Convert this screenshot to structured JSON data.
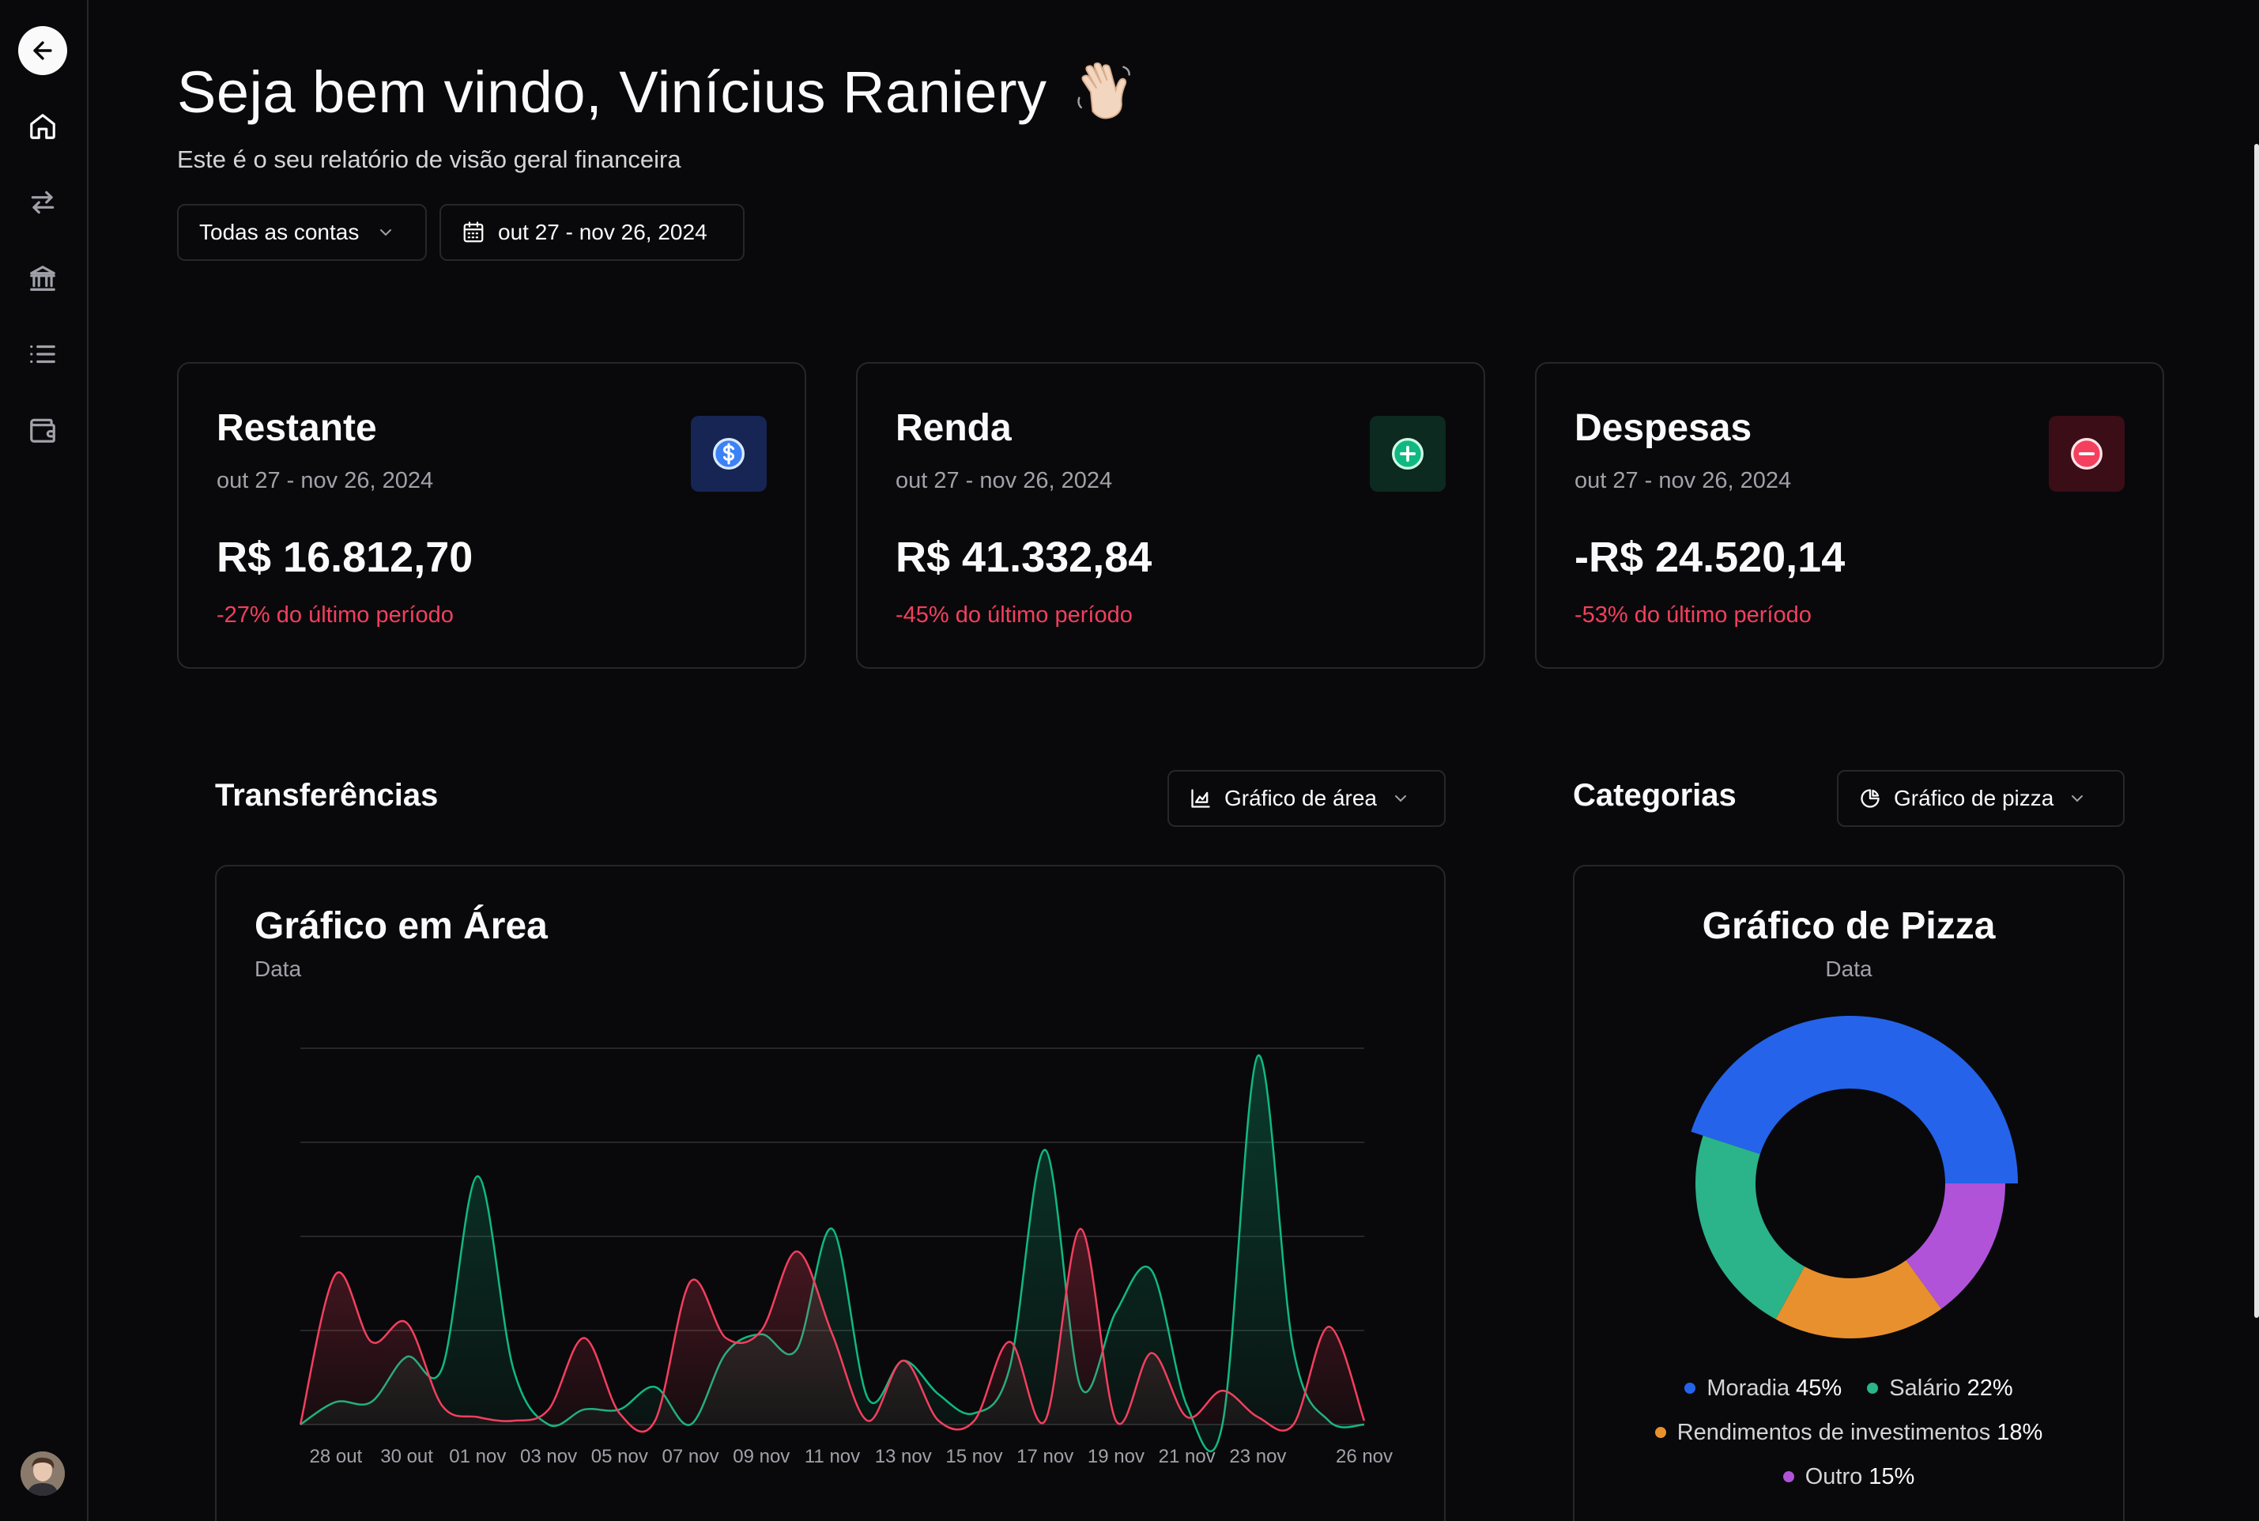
{
  "header": {
    "title": "Seja bem vindo, Vinícius Raniery",
    "subtitle": "Este é o seu relatório de visão geral financeira"
  },
  "filters": {
    "account_label": "Todas as contas",
    "date_range_label": "out 27 - nov 26, 2024"
  },
  "sidebar": {
    "items": [
      "home-icon",
      "transfers-icon",
      "bank-icon",
      "list-icon",
      "wallet-icon"
    ]
  },
  "cards": [
    {
      "title": "Restante",
      "date": "out 27 - nov 26, 2024",
      "value": "R$ 16.812,70",
      "change": "-27% do último período",
      "icon": "dollar-icon",
      "accent": "#3b82f6"
    },
    {
      "title": "Renda",
      "date": "out 27 - nov 26, 2024",
      "value": "R$ 41.332,84",
      "change": "-45% do último período",
      "icon": "plus-icon",
      "accent": "#10b981"
    },
    {
      "title": "Despesas",
      "date": "out 27 - nov 26, 2024",
      "value": "-R$ 24.520,14",
      "change": "-53% do último período",
      "icon": "minus-icon",
      "accent": "#f43f5e"
    }
  ],
  "transfers": {
    "section_title": "Transferências",
    "selector_label": "Gráfico de área",
    "panel_title": "Gráfico em Área",
    "panel_subtitle": "Data"
  },
  "categories": {
    "section_title": "Categorias",
    "selector_label": "Gráfico de pizza",
    "panel_title": "Gráfico de Pizza",
    "panel_subtitle": "Data"
  },
  "chart_data": [
    {
      "type": "area",
      "title": "Gráfico em Área",
      "subtitle": "Data",
      "x_tick_labels": [
        "28 out",
        "30 out",
        "01 nov",
        "03 nov",
        "05 nov",
        "07 nov",
        "09 nov",
        "11 nov",
        "13 nov",
        "15 nov",
        "17 nov",
        "19 nov",
        "21 nov",
        "23 nov",
        "26 nov"
      ],
      "x": [
        "27 out",
        "28 out",
        "29 out",
        "30 out",
        "31 out",
        "01 nov",
        "02 nov",
        "03 nov",
        "04 nov",
        "05 nov",
        "06 nov",
        "07 nov",
        "08 nov",
        "09 nov",
        "10 nov",
        "11 nov",
        "12 nov",
        "13 nov",
        "14 nov",
        "15 nov",
        "16 nov",
        "17 nov",
        "18 nov",
        "19 nov",
        "20 nov",
        "21 nov",
        "22 nov",
        "23 nov",
        "24 nov",
        "25 nov",
        "26 nov"
      ],
      "series": [
        {
          "color": "#10b981",
          "values": [
            0,
            12,
            12,
            36,
            30,
            132,
            30,
            0,
            8,
            8,
            20,
            0,
            38,
            48,
            40,
            104,
            14,
            34,
            16,
            6,
            30,
            146,
            20,
            60,
            82,
            10,
            0,
            196,
            40,
            2,
            0
          ]
        },
        {
          "color": "#f43f5e",
          "values": [
            0,
            80,
            44,
            54,
            10,
            4,
            2,
            8,
            46,
            6,
            2,
            76,
            46,
            50,
            92,
            48,
            2,
            34,
            2,
            2,
            44,
            2,
            104,
            2,
            38,
            4,
            18,
            4,
            0,
            52,
            2
          ]
        }
      ],
      "ylim": [
        0,
        200
      ],
      "grid": true
    },
    {
      "type": "pie",
      "title": "Gráfico de Pizza",
      "subtitle": "Data",
      "slices": [
        {
          "label": "Moradia",
          "value": 45,
          "display": "45%",
          "color": "#2563eb"
        },
        {
          "label": "Salário",
          "value": 22,
          "display": "22%",
          "color": "#2bb38a"
        },
        {
          "label": "Rendimentos de investimentos",
          "value": 18,
          "display": "18%",
          "color": "#e8902e"
        },
        {
          "label": "Outro",
          "value": 15,
          "display": "15%",
          "color": "#b053d9"
        }
      ]
    }
  ]
}
